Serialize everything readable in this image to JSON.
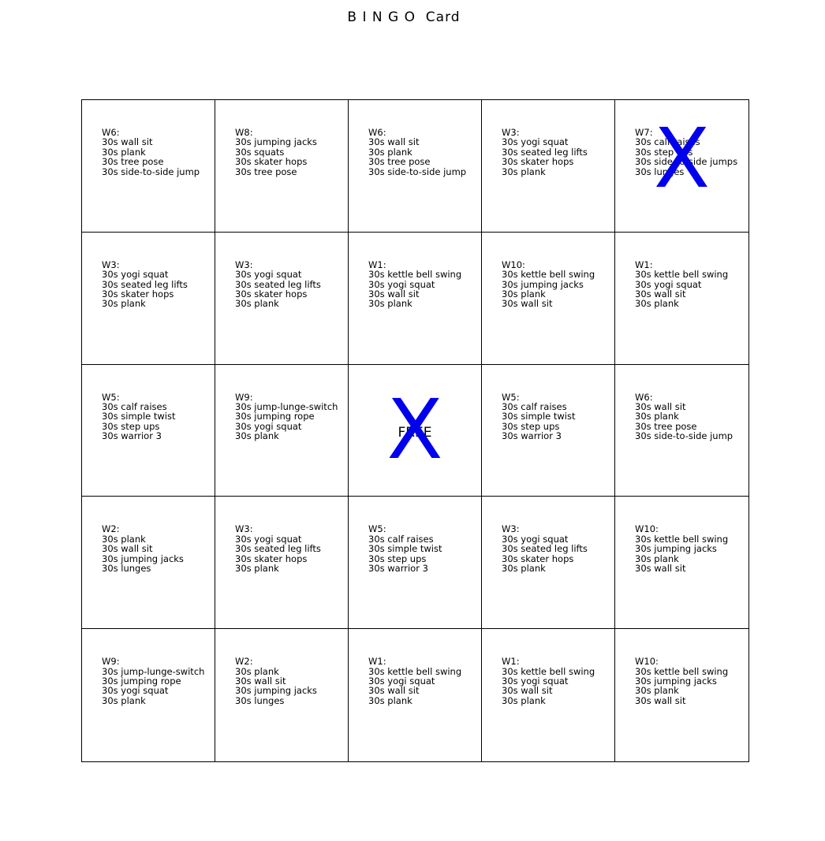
{
  "title": "B I N G O  Card",
  "mark_color": "#0000ee",
  "cells": [
    [
      {
        "label": "W6:",
        "items": [
          "30s wall sit",
          "30s plank",
          "30s tree pose",
          "30s side-to-side jump"
        ],
        "marked": false
      },
      {
        "label": "W8:",
        "items": [
          "30s jumping jacks",
          "30s squats",
          "30s skater hops",
          "30s tree pose"
        ],
        "marked": false
      },
      {
        "label": "W6:",
        "items": [
          "30s wall sit",
          "30s plank",
          "30s tree pose",
          "30s side-to-side jump"
        ],
        "marked": false
      },
      {
        "label": "W3:",
        "items": [
          "30s yogi squat",
          "30s seated leg lifts",
          "30s skater hops",
          "30s plank"
        ],
        "marked": false
      },
      {
        "label": "W7:",
        "items": [
          "30s calf raises",
          "30s step ups",
          "30s side-to-side jumps",
          "30s lunges"
        ],
        "marked": true,
        "mark": "X"
      }
    ],
    [
      {
        "label": "W3:",
        "items": [
          "30s yogi squat",
          "30s seated leg lifts",
          "30s skater hops",
          "30s plank"
        ],
        "marked": false
      },
      {
        "label": "W3:",
        "items": [
          "30s yogi squat",
          "30s seated leg lifts",
          "30s skater hops",
          "30s plank"
        ],
        "marked": false
      },
      {
        "label": "W1:",
        "items": [
          "30s kettle bell swing",
          "30s yogi squat",
          "30s wall sit",
          "30s plank"
        ],
        "marked": false
      },
      {
        "label": "W10:",
        "items": [
          "30s kettle bell swing",
          "30s jumping jacks",
          "30s plank",
          "30s wall sit"
        ],
        "marked": false
      },
      {
        "label": "W1:",
        "items": [
          "30s kettle bell swing",
          "30s yogi squat",
          "30s wall sit",
          "30s plank"
        ],
        "marked": false
      }
    ],
    [
      {
        "label": "W5:",
        "items": [
          "30s calf raises",
          "30s simple twist",
          "30s step ups",
          "30s warrior 3"
        ],
        "marked": false
      },
      {
        "label": "W9:",
        "items": [
          "30s jump-lunge-switch",
          "30s jumping rope",
          "30s yogi squat",
          "30s plank"
        ],
        "marked": false
      },
      {
        "free": "FREE",
        "marked": true,
        "mark": "X"
      },
      {
        "label": "W5:",
        "items": [
          "30s calf raises",
          "30s simple twist",
          "30s step ups",
          "30s warrior 3"
        ],
        "marked": false
      },
      {
        "label": "W6:",
        "items": [
          "30s wall sit",
          "30s plank",
          "30s tree pose",
          "30s side-to-side jump"
        ],
        "marked": false
      }
    ],
    [
      {
        "label": "W2:",
        "items": [
          "30s plank",
          "30s wall sit",
          "30s jumping jacks",
          "30s lunges"
        ],
        "marked": false
      },
      {
        "label": "W3:",
        "items": [
          "30s yogi squat",
          "30s seated leg lifts",
          "30s skater hops",
          "30s plank"
        ],
        "marked": false
      },
      {
        "label": "W5:",
        "items": [
          "30s calf raises",
          "30s simple twist",
          "30s step ups",
          "30s warrior 3"
        ],
        "marked": false
      },
      {
        "label": "W3:",
        "items": [
          "30s yogi squat",
          "30s seated leg lifts",
          "30s skater hops",
          "30s plank"
        ],
        "marked": false
      },
      {
        "label": "W10:",
        "items": [
          "30s kettle bell swing",
          "30s jumping jacks",
          "30s plank",
          "30s wall sit"
        ],
        "marked": false
      }
    ],
    [
      {
        "label": "W9:",
        "items": [
          "30s jump-lunge-switch",
          "30s jumping rope",
          "30s yogi squat",
          "30s plank"
        ],
        "marked": false
      },
      {
        "label": "W2:",
        "items": [
          "30s plank",
          "30s wall sit",
          "30s jumping jacks",
          "30s lunges"
        ],
        "marked": false
      },
      {
        "label": "W1:",
        "items": [
          "30s kettle bell swing",
          "30s yogi squat",
          "30s wall sit",
          "30s plank"
        ],
        "marked": false
      },
      {
        "label": "W1:",
        "items": [
          "30s kettle bell swing",
          "30s yogi squat",
          "30s wall sit",
          "30s plank"
        ],
        "marked": false
      },
      {
        "label": "W10:",
        "items": [
          "30s kettle bell swing",
          "30s jumping jacks",
          "30s plank",
          "30s wall sit"
        ],
        "marked": false
      }
    ]
  ]
}
